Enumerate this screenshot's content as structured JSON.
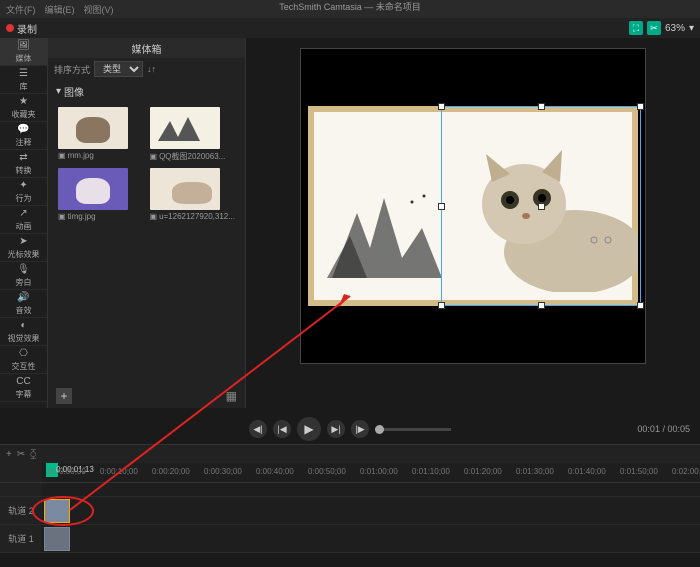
{
  "app": {
    "title": "TechSmith Camtasia — 未命名项目"
  },
  "toolbar": {
    "record": "录制",
    "zoom": "63%"
  },
  "sidebar": {
    "items": [
      {
        "label": "媒体"
      },
      {
        "label": "库"
      },
      {
        "label": "收藏夹"
      },
      {
        "label": "注释"
      },
      {
        "label": "转换"
      },
      {
        "label": "行为"
      },
      {
        "label": "动画"
      },
      {
        "label": "光标效果"
      },
      {
        "label": "旁白"
      },
      {
        "label": "音效"
      },
      {
        "label": "视觉效果"
      },
      {
        "label": "交互性"
      },
      {
        "label": "字幕"
      }
    ]
  },
  "media_panel": {
    "title": "媒体箱",
    "sort_label": "排序方式",
    "sort_value": "类型",
    "folder": "图像",
    "items": [
      {
        "name": "mm.jpg"
      },
      {
        "name": "QQ截图2020063..."
      },
      {
        "name": "timg.jpg"
      },
      {
        "name": "u=1262127920,312..."
      }
    ],
    "add": "+"
  },
  "playback": {
    "time_current": "00:01",
    "time_total": "00:05"
  },
  "timeline": {
    "playhead_time": "0:00:01;13",
    "ticks": [
      "0:00:00;00",
      "0:00:10;00",
      "0:00:20;00",
      "0:00:30;00",
      "0:00:40;00",
      "0:00:50;00",
      "0:01:00;00",
      "0:01:10;00",
      "0:01:20;00",
      "0:01:30;00",
      "0:01:40;00",
      "0:01:50;00",
      "0:02:00;00"
    ],
    "tracks": [
      {
        "label": "轨道 2"
      },
      {
        "label": "轨道 1"
      }
    ]
  }
}
